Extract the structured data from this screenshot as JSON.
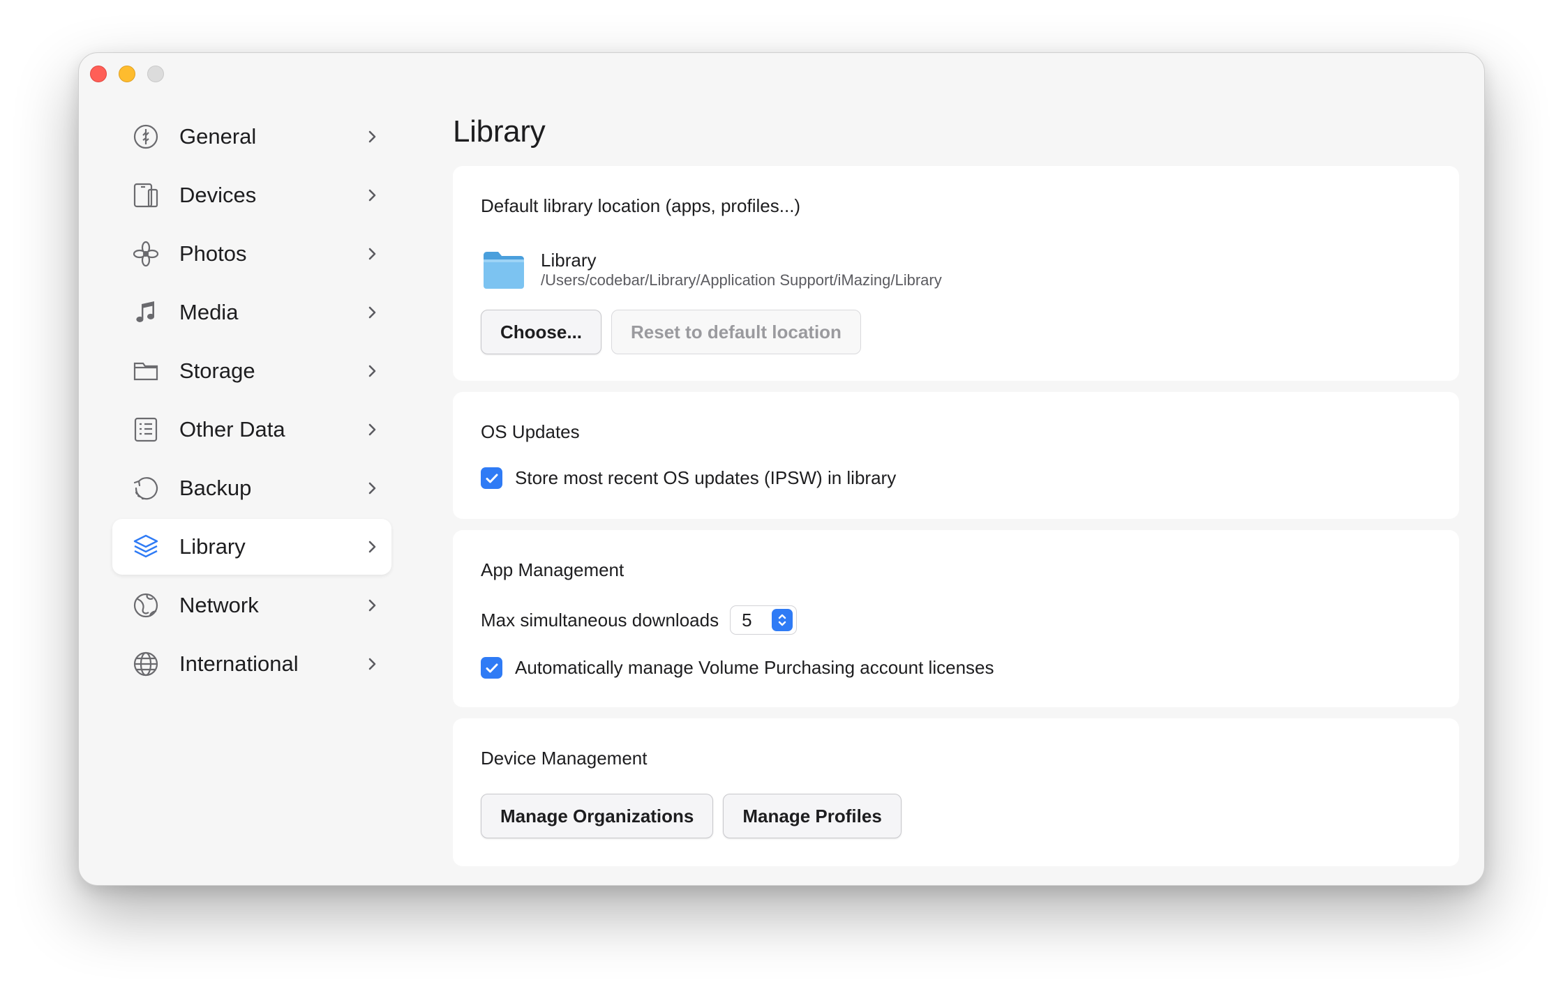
{
  "sidebar": {
    "items": [
      {
        "label": "General",
        "icon": "general-icon"
      },
      {
        "label": "Devices",
        "icon": "devices-icon"
      },
      {
        "label": "Photos",
        "icon": "photos-icon"
      },
      {
        "label": "Media",
        "icon": "music-note-icon"
      },
      {
        "label": "Storage",
        "icon": "folder-icon"
      },
      {
        "label": "Other Data",
        "icon": "list-icon"
      },
      {
        "label": "Backup",
        "icon": "backup-icon"
      },
      {
        "label": "Library",
        "icon": "layers-icon",
        "active": true
      },
      {
        "label": "Network",
        "icon": "network-globe-icon"
      },
      {
        "label": "International",
        "icon": "globe-icon"
      }
    ]
  },
  "main": {
    "title": "Library",
    "location": {
      "heading": "Default library location (apps, profiles...)",
      "name": "Library",
      "path": "/Users/codebar/Library/Application Support/iMazing/Library",
      "choose_label": "Choose...",
      "reset_label": "Reset to default location"
    },
    "os_updates": {
      "heading": "OS Updates",
      "store_label": "Store most recent OS updates (IPSW) in library",
      "store_checked": true
    },
    "app_management": {
      "heading": "App Management",
      "max_downloads_label": "Max simultaneous downloads",
      "max_downloads_value": "5",
      "vpp_label": "Automatically manage Volume Purchasing account licenses",
      "vpp_checked": true
    },
    "device_management": {
      "heading": "Device Management",
      "orgs_label": "Manage Organizations",
      "profiles_label": "Manage Profiles"
    }
  },
  "colors": {
    "accent": "#2f7bf5",
    "window_bg": "#f6f6f6",
    "card_bg": "#ffffff"
  }
}
